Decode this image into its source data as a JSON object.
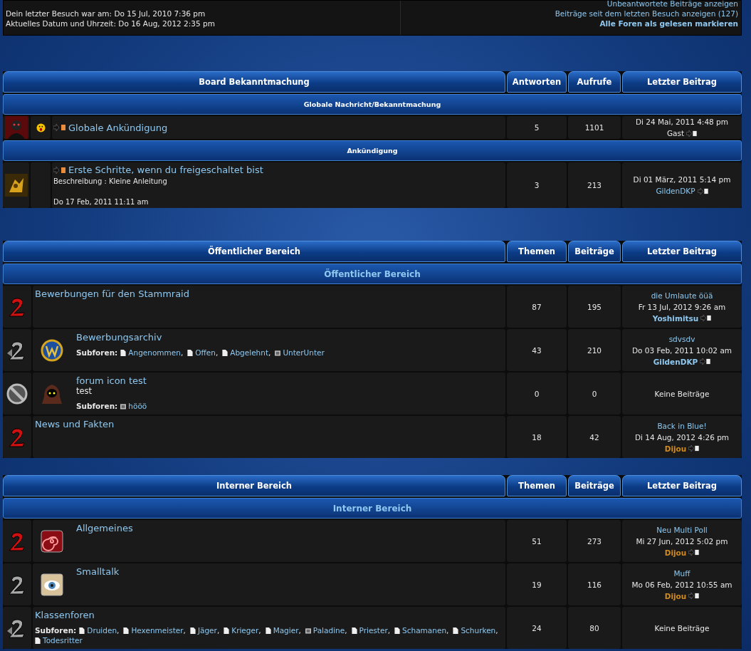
{
  "info": {
    "lines": [
      "Dein letzter Besuch war am: Do 15 Jul, 2010 7:36 pm",
      "Aktuelles Datum und Uhrzeit: Do 16 Aug, 2012 2:35 pm"
    ],
    "links": [
      {
        "text": "Unbeantwortete Beiträge anzeigen",
        "bold": false
      },
      {
        "text": "Beiträge seit dem letzten Besuch anzeigen (127)",
        "bold": false
      },
      {
        "text": "Alle Foren als gelesen markieren",
        "bold": true
      }
    ]
  },
  "announcements": {
    "columns": [
      "Board Bekanntmachung",
      "Antworten",
      "Aufrufe",
      "Letzter Beitrag"
    ],
    "groups": [
      {
        "title": "Globale Nachricht/Bekanntmachung",
        "topics": [
          {
            "emoticon": true,
            "title": "Globale Ankündigung",
            "replies": "5",
            "views": "1101",
            "last": {
              "date": "Di 24 Mai, 2011 4:48 pm",
              "author": "Gast",
              "color": "#e8e8e8"
            }
          }
        ]
      },
      {
        "title": "Ankündigung",
        "topics": [
          {
            "emoticon": false,
            "title": "Erste Schritte, wenn du freigeschaltet bist",
            "description": "Beschreibung : Kleine Anleitung",
            "date": "Do 17 Feb, 2011 11:11 am",
            "replies": "3",
            "views": "213",
            "last": {
              "date": "Di 01 März, 2011 5:14 pm",
              "author": "GildenDKP",
              "color": "#8ec8f0"
            }
          }
        ]
      }
    ]
  },
  "sections": [
    {
      "columns": [
        "Öffentlicher Bereich",
        "Themen",
        "Beiträge",
        "Letzter Beitrag"
      ],
      "category": "Öffentlicher Bereich",
      "forums": [
        {
          "unread": true,
          "locked": false,
          "name": "Bewerbungen für den Stammraid",
          "topics": "87",
          "posts": "195",
          "last": {
            "title": "die Umlaute öüä",
            "date": "Fr 13 Jul, 2012 9:26 am",
            "author": "Yoshimitsu",
            "color": "#8ec8f0"
          }
        },
        {
          "unread": false,
          "locked": false,
          "name": "Bewerbungsarchiv",
          "subforum_label": "Subforen:",
          "subforums": [
            {
              "name": "Angenommen",
              "kind": "page",
              "sep": ","
            },
            {
              "name": "Offen",
              "kind": "page",
              "sep": ","
            },
            {
              "name": "Abgelehnt",
              "kind": "page",
              "sep": ","
            },
            {
              "name": "UnterUnter",
              "kind": "folder"
            }
          ],
          "topics": "43",
          "posts": "210",
          "last": {
            "title": "sdvsdv",
            "date": "Do 03 Feb, 2011 10:02 am",
            "author": "GildenDKP",
            "color": "#8ec8f0"
          }
        },
        {
          "unread": false,
          "locked": true,
          "name": "forum icon test",
          "description": "test",
          "subforum_label": "Subforen:",
          "subforums": [
            {
              "name": "hööö",
              "kind": "folder"
            }
          ],
          "topics": "0",
          "posts": "0",
          "last": {
            "empty": "Keine Beiträge"
          }
        },
        {
          "unread": true,
          "locked": false,
          "name": "News und Fakten",
          "topics": "18",
          "posts": "42",
          "last": {
            "title": "Back in Blue!",
            "date": "Di 14 Aug, 2012 4:26 pm",
            "author": "Dijou",
            "color": "#d08a20"
          }
        }
      ]
    },
    {
      "columns": [
        "Interner Bereich",
        "Themen",
        "Beiträge",
        "Letzter Beitrag"
      ],
      "category": "Interner Bereich",
      "forums": [
        {
          "unread": true,
          "locked": false,
          "name": "Allgemeines",
          "topics": "51",
          "posts": "273",
          "last": {
            "title": "Neu Multi Poll",
            "date": "Mi 27 Jun, 2012 5:02 pm",
            "author": "Dijou",
            "color": "#d08a20"
          }
        },
        {
          "unread": false,
          "locked": false,
          "name": "Smalltalk",
          "topics": "19",
          "posts": "116",
          "last": {
            "title": "Muff",
            "date": "Mo 06 Feb, 2012 10:55 am",
            "author": "Dijou",
            "color": "#d08a20"
          }
        },
        {
          "unread": false,
          "locked": false,
          "name": "Klassenforen",
          "subforum_label": "Subforen:",
          "subforums": [
            {
              "name": "Druiden",
              "kind": "page",
              "sep": ","
            },
            {
              "name": "Hexenmeister",
              "kind": "page",
              "sep": ","
            },
            {
              "name": "Jäger",
              "kind": "page",
              "sep": ","
            },
            {
              "name": "Krieger",
              "kind": "page",
              "sep": ","
            },
            {
              "name": "Magier",
              "kind": "page",
              "sep": ","
            },
            {
              "name": "Paladine",
              "kind": "folder",
              "sep": ","
            },
            {
              "name": "Priester",
              "kind": "page",
              "sep": ","
            },
            {
              "name": "Schamanen",
              "kind": "page",
              "sep": ","
            },
            {
              "name": "Schurken",
              "kind": "page",
              "sep": ","
            },
            {
              "name": "Todesritter",
              "kind": "page"
            }
          ],
          "topics": "24",
          "posts": "80",
          "last": {
            "empty": "Keine Beiträge"
          }
        }
      ]
    }
  ]
}
